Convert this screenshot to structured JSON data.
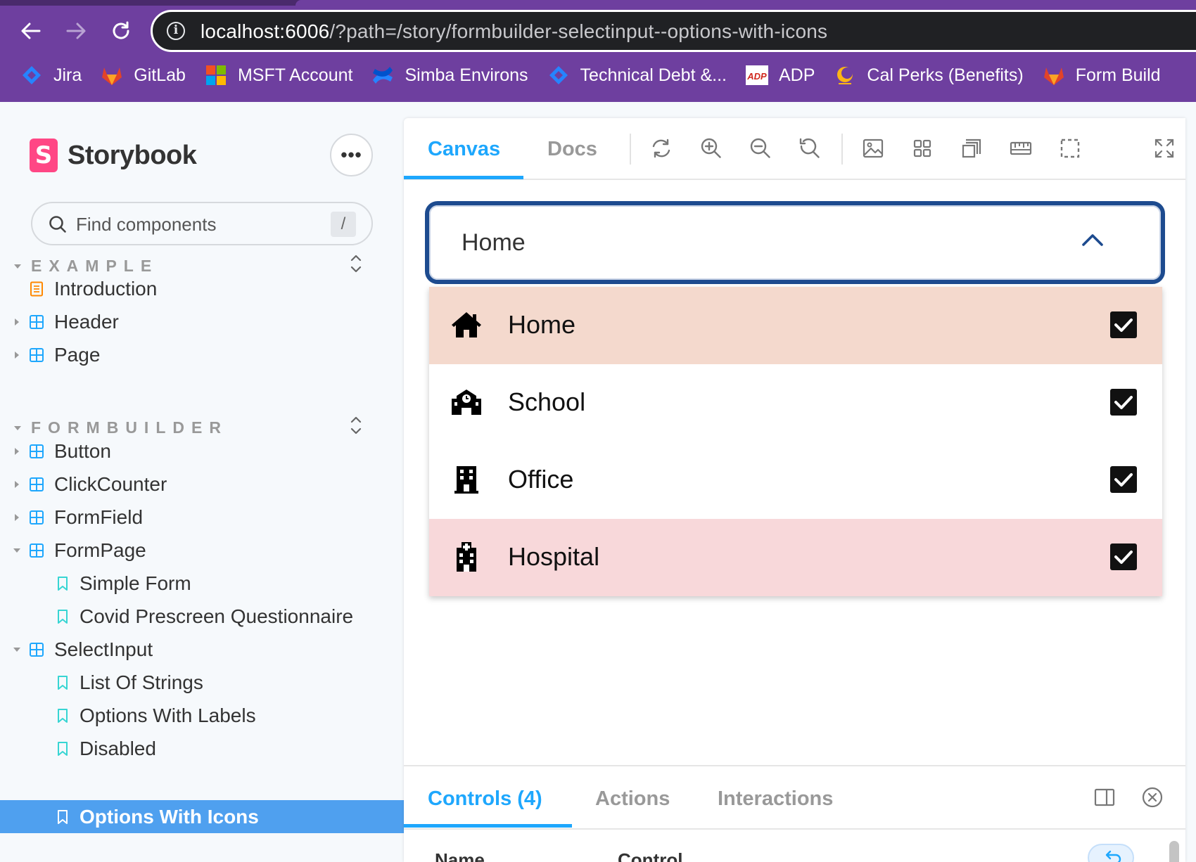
{
  "browser": {
    "url_host": "localhost:6006",
    "url_path": "/?path=/story/formbuilder-selectinput--options-with-icons",
    "nav": {
      "back_icon": "arrow-left-icon",
      "forward_icon": "arrow-right-icon",
      "reload_icon": "reload-icon",
      "info_icon": "i"
    },
    "bookmarks": [
      {
        "label": "Jira",
        "icon": "jira-icon"
      },
      {
        "label": "GitLab",
        "icon": "gitlab-icon"
      },
      {
        "label": "MSFT Account",
        "icon": "microsoft-icon"
      },
      {
        "label": "Simba Environs",
        "icon": "confluence-icon"
      },
      {
        "label": "Technical Debt &...",
        "icon": "jira-icon"
      },
      {
        "label": "ADP",
        "icon": "adp-icon"
      },
      {
        "label": "Cal Perks (Benefits)",
        "icon": "cal-perks-icon"
      },
      {
        "label": "Form Build",
        "icon": "gitlab-icon"
      }
    ],
    "bookmark_adp_logo_text": "ADP"
  },
  "sidebar": {
    "brand_mark": "S",
    "brand": "Storybook",
    "more_label": "•••",
    "search": {
      "placeholder": "Find components",
      "shortcut": "/"
    },
    "sections": [
      {
        "title": "EXAMPLE",
        "items": [
          {
            "label": "Introduction",
            "kind": "doc"
          },
          {
            "label": "Header",
            "kind": "component"
          },
          {
            "label": "Page",
            "kind": "component"
          }
        ]
      },
      {
        "title": "FORMBUILDER",
        "items": [
          {
            "label": "Button",
            "kind": "component"
          },
          {
            "label": "ClickCounter",
            "kind": "component"
          },
          {
            "label": "FormField",
            "kind": "component"
          },
          {
            "label": "FormPage",
            "kind": "component"
          },
          {
            "label": "Simple Form",
            "kind": "story"
          },
          {
            "label": "Covid Prescreen Questionnaire",
            "kind": "story"
          },
          {
            "label": "SelectInput",
            "kind": "component"
          },
          {
            "label": "List Of Strings",
            "kind": "story"
          },
          {
            "label": "Options With Labels",
            "kind": "story"
          },
          {
            "label": "Disabled",
            "kind": "story"
          },
          {
            "label": "Options With Icons",
            "kind": "story",
            "selected": true
          }
        ]
      }
    ]
  },
  "toolbar": {
    "tabs": [
      "Canvas",
      "Docs"
    ],
    "active_tab": "Canvas",
    "icons": [
      "remount-icon",
      "zoom-in-icon",
      "zoom-out-icon",
      "zoom-reset-icon",
      "background-icon",
      "grid-icon",
      "viewport-icon",
      "measure-icon",
      "outline-icon",
      "fullscreen-icon"
    ]
  },
  "select": {
    "value": "Home",
    "expanded": true,
    "options": [
      {
        "label": "Home",
        "icon": "home-icon",
        "checked": true,
        "bg": "#f4d9cd"
      },
      {
        "label": "School",
        "icon": "school-icon",
        "checked": true,
        "bg": "#ffffff"
      },
      {
        "label": "Office",
        "icon": "office-building-icon",
        "checked": true,
        "bg": "#ffffff"
      },
      {
        "label": "Hospital",
        "icon": "hospital-icon",
        "checked": true,
        "bg": "#f8d8da"
      }
    ]
  },
  "addons": {
    "tabs": [
      "Controls (4)",
      "Actions",
      "Interactions"
    ],
    "active_tab": "Controls (4)",
    "columns": [
      "Name",
      "Control"
    ]
  },
  "colors": {
    "chrome": "#6e3f9f",
    "accent": "#1ea7fd",
    "selected_row": "#4fa0ef",
    "select_border": "#1d4b8f",
    "storybook_pink": "#ff4785"
  }
}
